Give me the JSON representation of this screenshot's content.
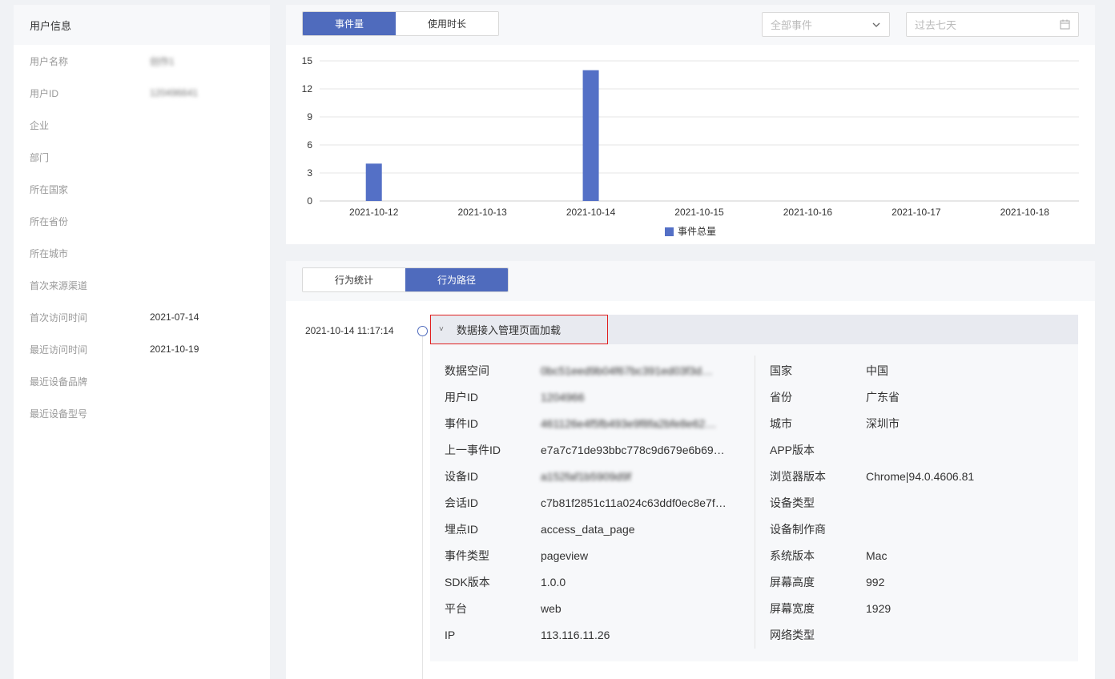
{
  "user_info": {
    "title": "用户信息",
    "rows": [
      {
        "label": "用户名称",
        "value": "创作1",
        "blurred": true
      },
      {
        "label": "用户ID",
        "value": "120496641",
        "blurred": true
      },
      {
        "label": "企业",
        "value": ""
      },
      {
        "label": "部门",
        "value": ""
      },
      {
        "label": "所在国家",
        "value": ""
      },
      {
        "label": "所在省份",
        "value": ""
      },
      {
        "label": "所在城市",
        "value": ""
      },
      {
        "label": "首次来源渠道",
        "value": ""
      },
      {
        "label": "首次访问时间",
        "value": "2021-07-14"
      },
      {
        "label": "最近访问时间",
        "value": "2021-10-19"
      },
      {
        "label": "最近设备品牌",
        "value": ""
      },
      {
        "label": "最近设备型号",
        "value": ""
      }
    ]
  },
  "chart_panel": {
    "tabs": [
      "事件量",
      "使用时长"
    ],
    "active_tab": "事件量",
    "event_select": {
      "value": "全部事件",
      "icon": "chevron-down-icon"
    },
    "date_select": {
      "value": "过去七天",
      "icon": "calendar-icon"
    }
  },
  "chart_data": {
    "type": "bar",
    "categories": [
      "2021-10-12",
      "2021-10-13",
      "2021-10-14",
      "2021-10-15",
      "2021-10-16",
      "2021-10-17",
      "2021-10-18"
    ],
    "series": [
      {
        "name": "事件总量",
        "values": [
          4,
          0,
          14,
          0,
          0,
          0,
          0
        ],
        "color": "#5470c6"
      }
    ],
    "yticks": [
      0,
      3,
      6,
      9,
      12,
      15
    ],
    "ylim": [
      0,
      15
    ],
    "grid": true,
    "legend": "bottom-center"
  },
  "behavior_panel": {
    "tabs": [
      "行为统计",
      "行为路径"
    ],
    "active_tab": "行为路径",
    "event": {
      "time": "2021-10-14 11:17:14",
      "title": "数据接入管理页面加载",
      "left": [
        {
          "label": "数据空间",
          "value": "0bc51eed9b04f67bc391ed03f3d…",
          "blurred": true
        },
        {
          "label": "用户ID",
          "value": "1204966",
          "blurred": true
        },
        {
          "label": "事件ID",
          "value": "461126e4f5fb493e9f8fa2bfe8e62…",
          "blurred": true
        },
        {
          "label": "上一事件ID",
          "value": "e7a7c71de93bbc778c9d679e6b69…"
        },
        {
          "label": "设备ID",
          "value": "a152faf1b5909d9f",
          "blurred": true
        },
        {
          "label": "会话ID",
          "value": "c7b81f2851c11a024c63ddf0ec8e7f…"
        },
        {
          "label": "埋点ID",
          "value": "access_data_page"
        },
        {
          "label": "事件类型",
          "value": "pageview"
        },
        {
          "label": "SDK版本",
          "value": "1.0.0"
        },
        {
          "label": "平台",
          "value": "web"
        },
        {
          "label": "IP",
          "value": "113.116.11.26"
        }
      ],
      "right": [
        {
          "label": "国家",
          "value": "中国"
        },
        {
          "label": "省份",
          "value": "广东省"
        },
        {
          "label": "城市",
          "value": "深圳市"
        },
        {
          "label": "APP版本",
          "value": ""
        },
        {
          "label": "浏览器版本",
          "value": "Chrome|94.0.4606.81"
        },
        {
          "label": "设备类型",
          "value": ""
        },
        {
          "label": "设备制作商",
          "value": ""
        },
        {
          "label": "系统版本",
          "value": "Mac"
        },
        {
          "label": "屏幕高度",
          "value": "992"
        },
        {
          "label": "屏幕宽度",
          "value": "1929"
        },
        {
          "label": "网络类型",
          "value": ""
        }
      ]
    }
  }
}
